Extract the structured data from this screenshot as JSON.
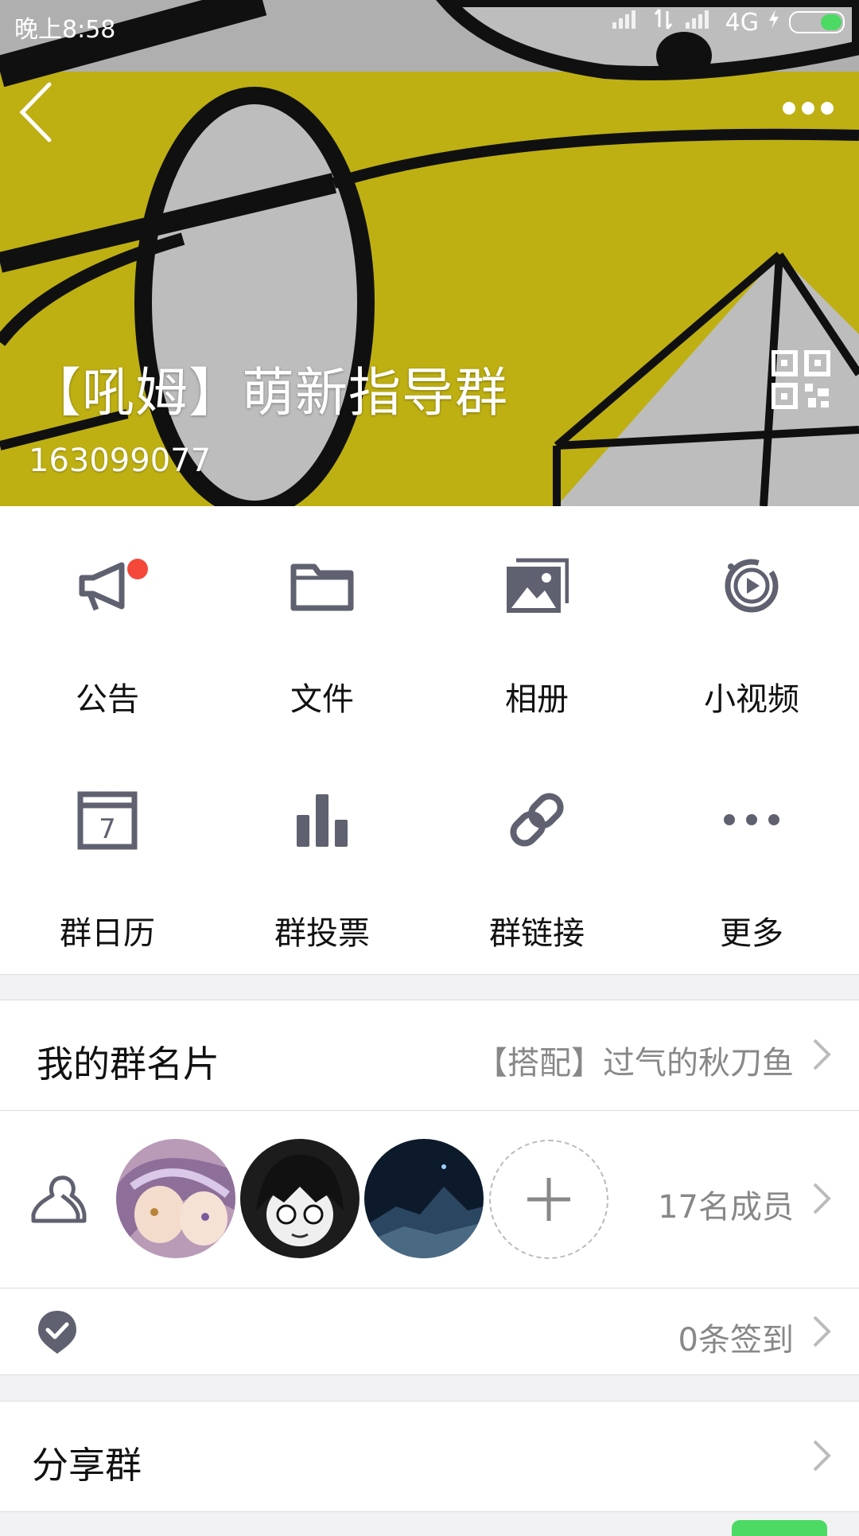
{
  "status_bar": {
    "time": "晚上8:58",
    "network": "4G"
  },
  "header": {
    "group_name": "【吼姆】萌新指导群",
    "group_id": "163099077"
  },
  "features": [
    {
      "label": "公告",
      "icon": "megaphone-icon",
      "badge": true
    },
    {
      "label": "文件",
      "icon": "folder-icon"
    },
    {
      "label": "相册",
      "icon": "photo-album-icon"
    },
    {
      "label": "小视频",
      "icon": "short-video-icon"
    },
    {
      "label": "群日历",
      "icon": "calendar-icon",
      "calendar_day": "7"
    },
    {
      "label": "群投票",
      "icon": "bar-chart-icon"
    },
    {
      "label": "群链接",
      "icon": "link-icon"
    },
    {
      "label": "更多",
      "icon": "more-dots-icon"
    }
  ],
  "group_card": {
    "label": "我的群名片",
    "value": "【搭配】过气的秋刀鱼"
  },
  "members": {
    "count_text": "17名成员",
    "icon": "members-icon"
  },
  "checkin": {
    "count_text": "0条签到",
    "icon": "checkin-icon"
  },
  "share": {
    "label": "分享群"
  },
  "colors": {
    "header_yellow": "#c9ba13",
    "icon_gray": "#5f6170",
    "badge_red": "#f4483b"
  }
}
